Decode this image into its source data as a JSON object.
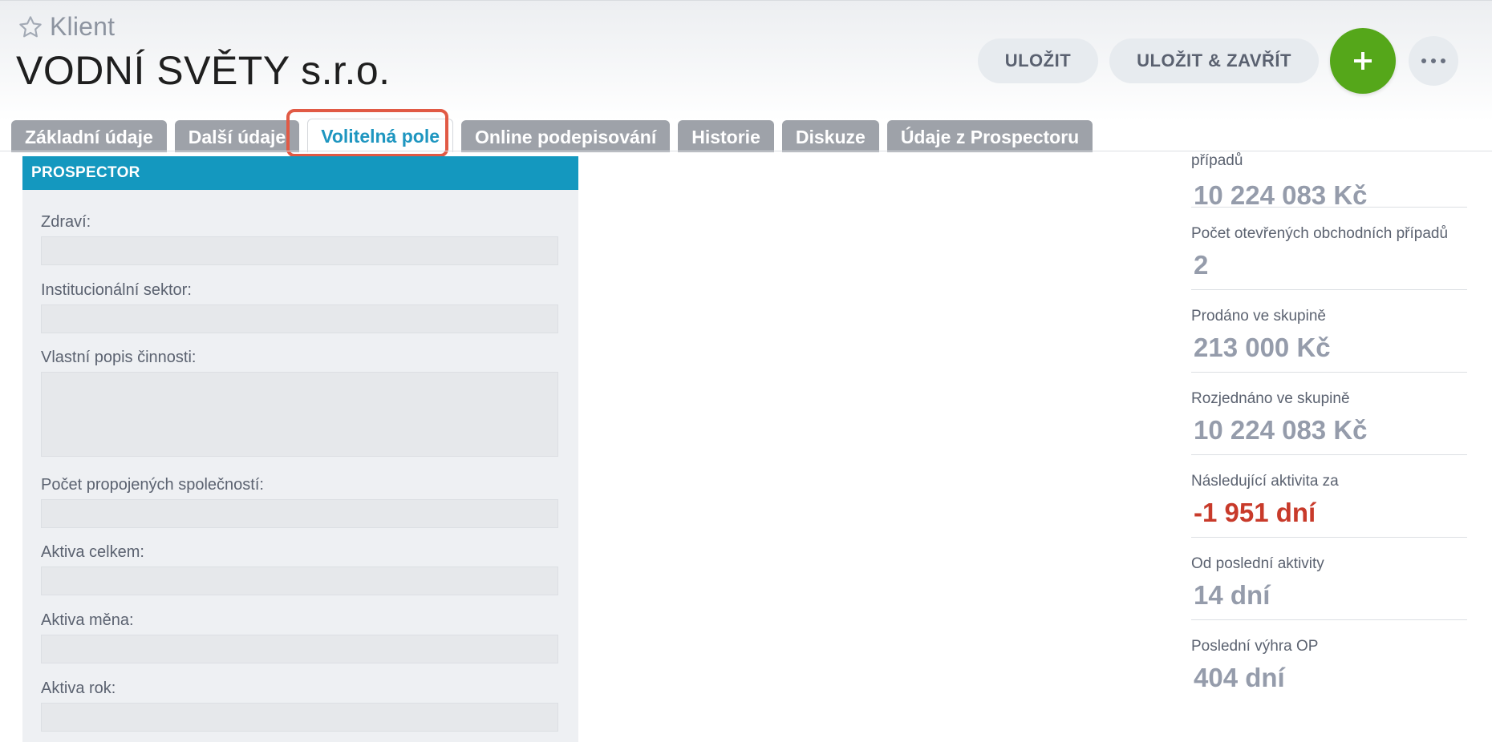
{
  "header": {
    "entity_type": "Klient",
    "title": "VODNÍ SVĚTY s.r.o.",
    "icons": [
      "star-icon",
      "plus-icon",
      "more-icon"
    ]
  },
  "actions": {
    "save_label": "ULOŽIT",
    "save_close_label": "ULOŽIT & ZAVŘÍT"
  },
  "tabs": [
    {
      "label": "Základní údaje"
    },
    {
      "label": "Další údaje"
    },
    {
      "label": "Volitelná pole",
      "active": true
    },
    {
      "label": "Online podepisování"
    },
    {
      "label": "Historie"
    },
    {
      "label": "Diskuze"
    },
    {
      "label": "Údaje z Prospectoru"
    }
  ],
  "panel": {
    "title": "PROSPECTOR",
    "fields": [
      {
        "label": "Zdraví:",
        "value": ""
      },
      {
        "label": "Institucionální sektor:",
        "value": ""
      },
      {
        "label": "Vlastní popis činnosti:",
        "value": ""
      },
      {
        "label": "Počet propojených společností:",
        "value": ""
      },
      {
        "label": "Aktiva celkem:",
        "value": ""
      },
      {
        "label": "Aktiva měna:",
        "value": ""
      },
      {
        "label": "Aktiva rok:",
        "value": ""
      }
    ]
  },
  "stats": [
    {
      "label": "případů",
      "value": "10 224 083 Kč"
    },
    {
      "label": "Počet otevřených obchodních případů",
      "value": "2"
    },
    {
      "label": "Prodáno ve skupině",
      "value": "213 000 Kč"
    },
    {
      "label": "Rozjednáno ve skupině",
      "value": "10 224 083 Kč"
    },
    {
      "label": "Následující aktivita za",
      "value": "-1 951 dní",
      "status": "negative"
    },
    {
      "label": "Od poslední aktivity",
      "value": "14 dní"
    },
    {
      "label": "Poslední výhra OP",
      "value": "404 dní"
    }
  ],
  "colors": {
    "accent": "#1498bf",
    "active_tab_text": "#1e96c0",
    "add_button": "#55a71a",
    "negative": "#c83a2a",
    "tab_bg": "#9ea2a9",
    "highlight": "#e15a45"
  }
}
